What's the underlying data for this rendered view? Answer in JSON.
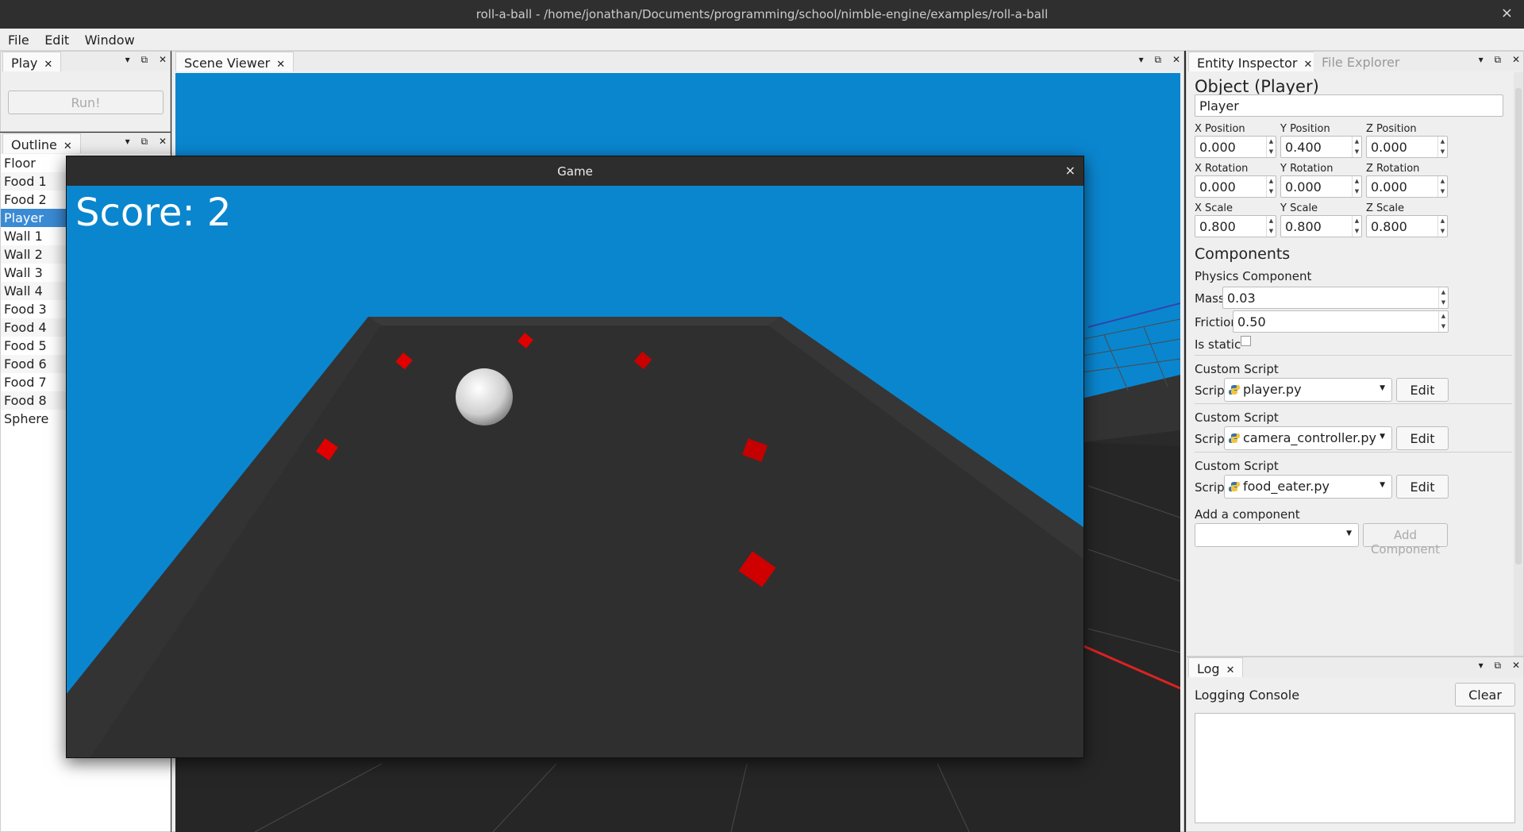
{
  "window": {
    "title": "roll-a-ball - /home/jonathan/Documents/programming/school/nimble-engine/examples/roll-a-ball",
    "close": "×"
  },
  "menu": [
    "File",
    "Edit",
    "Window"
  ],
  "dock_buttons": {
    "dropdown": "▾",
    "float": "⧉",
    "close": "✕"
  },
  "play_panel": {
    "tab": "Play",
    "run_label": "Run!"
  },
  "outline": {
    "tab": "Outline",
    "items": [
      "Floor",
      "Food 1",
      "Food 2",
      "Player",
      "Wall 1",
      "Wall 2",
      "Wall 3",
      "Wall 4",
      "Food 3",
      "Food 4",
      "Food 5",
      "Food 6",
      "Food 7",
      "Food 8",
      "Sphere"
    ],
    "selected": "Player"
  },
  "scene_viewer": {
    "tab": "Scene Viewer"
  },
  "game": {
    "title": "Game",
    "close": "×",
    "score": "Score: 2",
    "sky_color": "#0a86cf",
    "food_color": "#e10000"
  },
  "inspector": {
    "tab_active": "Entity Inspector",
    "tab_inactive": "File Explorer",
    "heading": "Object (Player)",
    "name_value": "Player",
    "fields": [
      {
        "label": "X Position",
        "value": "0.000"
      },
      {
        "label": "Y Position",
        "value": "0.400"
      },
      {
        "label": "Z Position",
        "value": "0.000"
      },
      {
        "label": "X Rotation",
        "value": "0.000"
      },
      {
        "label": "Y Rotation",
        "value": "0.000"
      },
      {
        "label": "Z Rotation",
        "value": "0.000"
      },
      {
        "label": "X Scale",
        "value": "0.800"
      },
      {
        "label": "Y Scale",
        "value": "0.800"
      },
      {
        "label": "Z Scale",
        "value": "0.800"
      }
    ],
    "components_heading": "Components",
    "physics": {
      "title": "Physics Component",
      "mass_label": "Mass",
      "mass_value": "0.03",
      "friction_label": "Friction",
      "friction_value": "0.50",
      "static_label": "Is static",
      "static_checked": false
    },
    "scripts": [
      {
        "title": "Custom Script",
        "label": "Script",
        "file": "player.py",
        "edit": "Edit"
      },
      {
        "title": "Custom Script",
        "label": "Script",
        "file": "camera_controller.py",
        "edit": "Edit"
      },
      {
        "title": "Custom Script",
        "label": "Script",
        "file": "food_eater.py",
        "edit": "Edit"
      }
    ],
    "add_component_label": "Add a component",
    "add_component_button": "Add Component"
  },
  "log": {
    "tab": "Log",
    "title": "Logging Console",
    "clear": "Clear"
  },
  "colors": {
    "selection": "#3a8ad4",
    "panel_bg": "#efefef"
  }
}
